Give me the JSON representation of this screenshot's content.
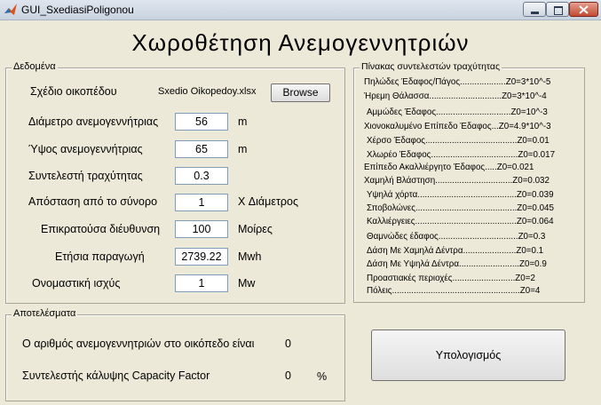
{
  "window": {
    "title": "GUI_SxediasiPoligonou"
  },
  "main_title": "Χωροθέτηση  Ανεμογεννητριών",
  "data_group": {
    "label": "Δεδομένα",
    "plan_label": "Σχέδιο οικοπέδου",
    "plan_file": "Sxedio Oikopedoy.xlsx",
    "browse_label": "Browse",
    "fields": [
      {
        "label": "Διάμετρο ανεμογεννήτριας",
        "value": "56",
        "unit": "m"
      },
      {
        "label": "Ύψος ανεμογεννήτριας",
        "value": "65",
        "unit": "m"
      },
      {
        "label": "Συντελεστή τραχύτητας",
        "value": "0.3",
        "unit": ""
      },
      {
        "label": "Απόσταση από το σύνορο",
        "value": "1",
        "unit": "X Διάμετρος"
      },
      {
        "label": "Επικρατούσα διέυθυνση",
        "value": "100",
        "unit": "Μοίρες"
      },
      {
        "label": "Ετήσια παραγωγή",
        "value": "2739.22",
        "unit": "Mwh"
      },
      {
        "label": "Ονομαστική ισχύς",
        "value": "1",
        "unit": "Mw"
      }
    ]
  },
  "coef_table": {
    "label": "Πίνακας συντελεστών τραχύτητας",
    "rows": [
      "Πηλώδες Έδαφος/Πάγος...................Z0=3*10^-5",
      "Ήρεμη Θάλασσα..............................Z0=3*10^-4",
      "Αμμώδες Έδαφος...............................Z0=10^-3",
      "Χιονοκαλυμένο Επίπεδο Έδαφος...Z0=4.9*10^-3",
      "Χέρσο Έδαφος......................................Z0=0.01",
      "Χλωρέο Έδαφος....................................Z0=0.017",
      "Επίπεδο Ακαλλιέργητο Έδαφος.....Z0=0.021",
      "Χαμηλή Βλάστηση................................Z0=0.032",
      "Υψηλά χόρτα.........................................Z0=0.039",
      "Σποβολώνες..........................................Z0=0.045",
      "Καλλιέργειες..........................................Z0=0.064",
      "Θαμνώδες έδαφος.................................Z0=0.3",
      "Δάση Με Χαμηλά Δέντρα......................Z0=0.1",
      "Δάση Με Υψηλά Δέντρα.........................Z0=0.9",
      "Προαστιακές περιοχές..........................Z0=2",
      "Πόλεις.....................................................Z0=4"
    ]
  },
  "results_group": {
    "label": "Αποτελέσματα",
    "turbines_label": "Ο αριθμός ανεμογεννητριών στο οικόπεδο είναι",
    "turbines_value": "0",
    "capacity_label": "Συντελεστής κάλυψης Capacity Factor",
    "capacity_value": "0",
    "capacity_unit": "%"
  },
  "calc_button": "Υπολογισμός"
}
